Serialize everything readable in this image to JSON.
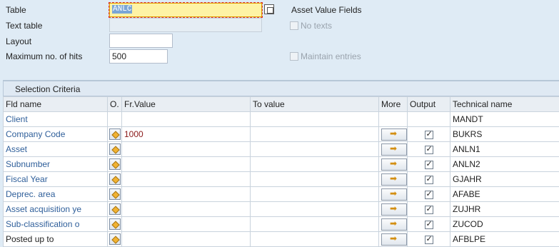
{
  "form": {
    "table_label": "Table",
    "table_value": "ANLC",
    "text_table_label": "Text table",
    "text_table_value": "",
    "layout_label": "Layout",
    "layout_value": "",
    "max_hits_label": "Maximum no. of hits",
    "max_hits_value": "500",
    "asset_value_fields": "Asset Value Fields",
    "no_texts": "No texts",
    "maintain_entries": "Maintain entries"
  },
  "section": {
    "title": "Selection Criteria",
    "columns": [
      "Fld name",
      "O.",
      "Fr.Value",
      "To value",
      "More",
      "Output",
      "Technical name"
    ]
  },
  "rows": [
    {
      "name": "Client",
      "fr": "",
      "to": "",
      "tech": "MANDT",
      "has_controls": false
    },
    {
      "name": "Company Code",
      "fr": "1000",
      "to": "",
      "tech": "BUKRS",
      "has_controls": true
    },
    {
      "name": "Asset",
      "fr": "",
      "to": "",
      "tech": "ANLN1",
      "has_controls": true
    },
    {
      "name": "Subnumber",
      "fr": "",
      "to": "",
      "tech": "ANLN2",
      "has_controls": true
    },
    {
      "name": "Fiscal Year",
      "fr": "",
      "to": "",
      "tech": "GJAHR",
      "has_controls": true
    },
    {
      "name": "Deprec. area",
      "fr": "",
      "to": "",
      "tech": "AFABE",
      "has_controls": true
    },
    {
      "name": "Asset acquisition ye",
      "fr": "",
      "to": "",
      "tech": "ZUJHR",
      "has_controls": true
    },
    {
      "name": "Sub-classification o",
      "fr": "",
      "to": "",
      "tech": "ZUCOD",
      "has_controls": true
    },
    {
      "name": "Posted up to",
      "fr": "",
      "to": "",
      "tech": "AFBLPE",
      "has_controls": true,
      "plain": true
    }
  ]
}
